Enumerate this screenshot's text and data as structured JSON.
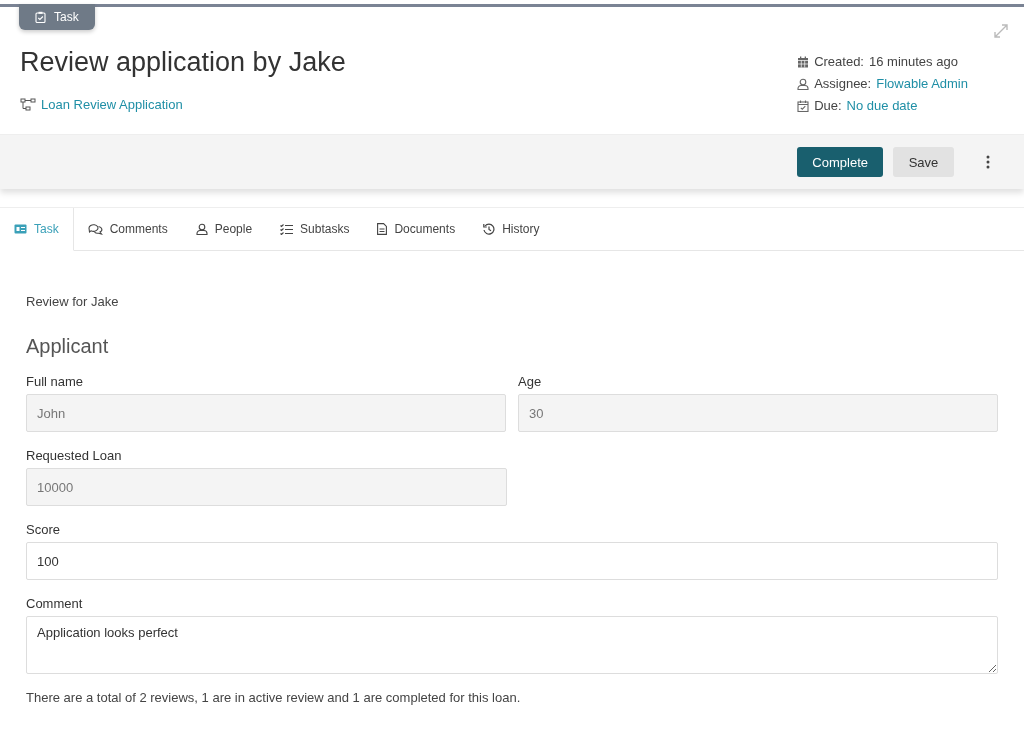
{
  "badge": {
    "label": "Task"
  },
  "title": "Review application by Jake",
  "process_link": "Loan Review Application",
  "meta": [
    {
      "kind": "created",
      "label": "Created:",
      "value": "16 minutes ago",
      "link": false
    },
    {
      "kind": "assignee",
      "label": "Assignee:",
      "value": "Flowable Admin",
      "link": true
    },
    {
      "kind": "due",
      "label": "Due:",
      "value": "No due date",
      "link": true
    }
  ],
  "buttons": [
    {
      "label": "Complete",
      "kind": "primary"
    },
    {
      "label": "Save",
      "kind": "secondary"
    }
  ],
  "tabs": [
    {
      "label": "Task",
      "kind": "task",
      "selected": true
    },
    {
      "label": "Comments",
      "kind": "comments",
      "selected": false
    },
    {
      "label": "People",
      "kind": "people",
      "selected": false
    },
    {
      "label": "Subtasks",
      "kind": "subtasks",
      "selected": false
    },
    {
      "label": "Documents",
      "kind": "documents",
      "selected": false
    },
    {
      "label": "History",
      "kind": "history",
      "selected": false
    }
  ],
  "form": {
    "intro": "Review for Jake",
    "section": "Applicant",
    "rows": [
      [
        {
          "label": "Full name",
          "value": "John",
          "disabled": true,
          "kind": "input"
        },
        {
          "label": "Age",
          "value": "30",
          "disabled": true,
          "kind": "input"
        }
      ],
      [
        {
          "label": "Requested Loan",
          "value": "10000",
          "disabled": true,
          "kind": "input"
        }
      ],
      [
        {
          "label": "Score",
          "value": "100",
          "disabled": false,
          "kind": "input",
          "wide": true
        }
      ],
      [
        {
          "label": "Comment",
          "value": "Application looks perfect",
          "disabled": false,
          "kind": "textarea",
          "wide": true
        }
      ]
    ],
    "summary": "There are a total of 2 reviews, 1 are in active review and 1 are completed for this loan."
  }
}
